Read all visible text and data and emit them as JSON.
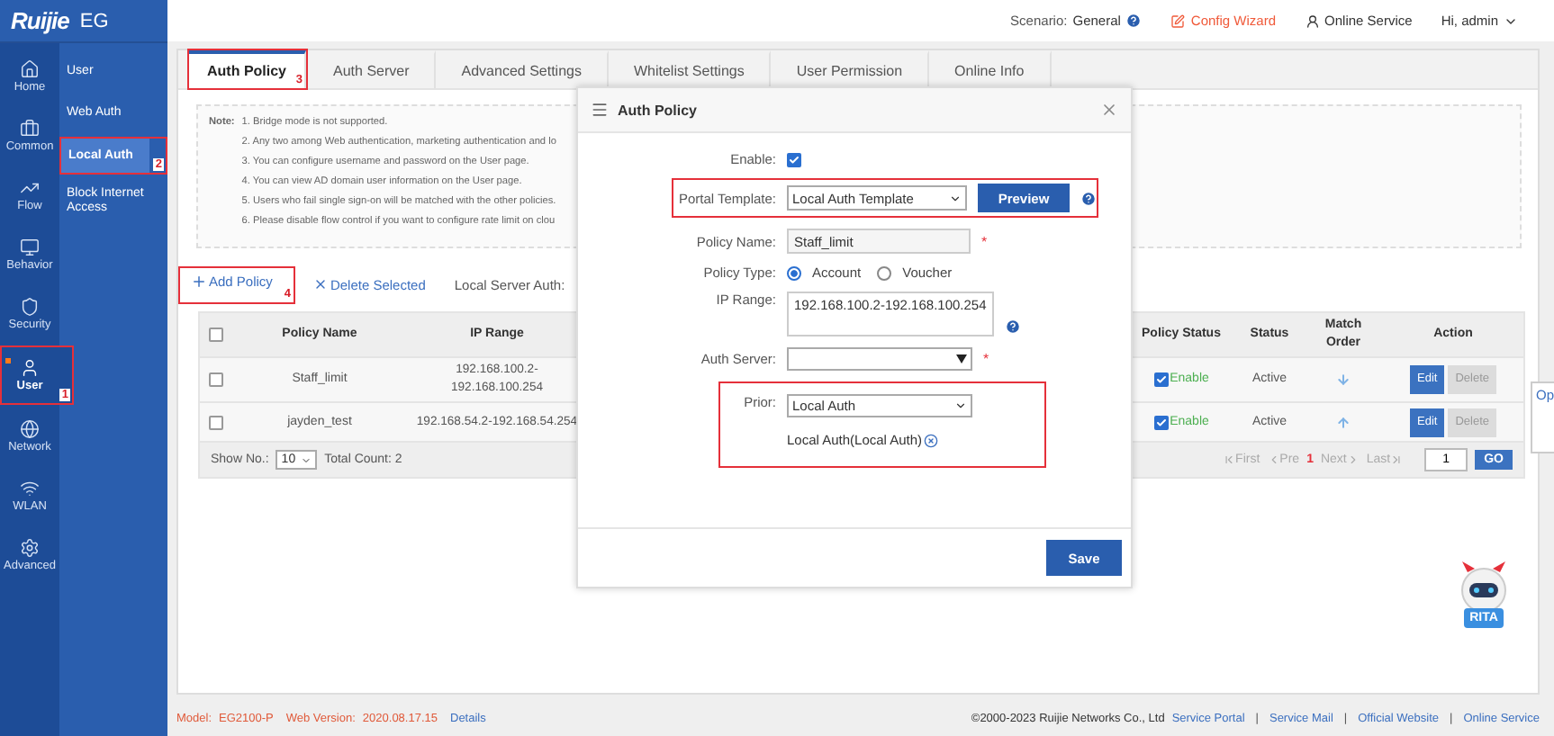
{
  "logo": {
    "brand": "Ruijie",
    "product": "EG"
  },
  "top_bar": {
    "scenario_label": "Scenario:",
    "scenario_value": "General",
    "config_wizard": "Config Wizard",
    "online_service": "Online Service",
    "user_menu": "Hi, admin"
  },
  "nav_rail": [
    {
      "label": "Home",
      "selected": false
    },
    {
      "label": "Common",
      "selected": false
    },
    {
      "label": "Flow",
      "selected": false
    },
    {
      "label": "Behavior",
      "selected": false
    },
    {
      "label": "Security",
      "selected": false
    },
    {
      "label": "User",
      "selected": true,
      "callout": "1"
    },
    {
      "label": "Network",
      "selected": false
    },
    {
      "label": "WLAN",
      "selected": false
    },
    {
      "label": "Advanced",
      "selected": false
    }
  ],
  "submenu": [
    {
      "label": "User",
      "selected": false
    },
    {
      "label": "Web Auth",
      "selected": false
    },
    {
      "label": "Local Auth",
      "selected": true,
      "callout": "2"
    },
    {
      "label": "Block Internet Access",
      "selected": false
    }
  ],
  "tabs": [
    {
      "label": "Auth Policy",
      "selected": true,
      "callout": "3"
    },
    {
      "label": "Auth Server",
      "selected": false
    },
    {
      "label": "Advanced Settings",
      "selected": false
    },
    {
      "label": "Whitelist Settings",
      "selected": false
    },
    {
      "label": "User Permission",
      "selected": false
    },
    {
      "label": "Online Info",
      "selected": false
    }
  ],
  "notes": {
    "label": "Note:",
    "lines": [
      "1. Bridge mode is not supported.",
      "2. Any two among Web authentication, marketing authentication and lo",
      "3. You can configure username and password on the User page.",
      "4. You can view AD domain user information on the User page.",
      "5. Users who fail single sign-on will be matched with the other policies.",
      "6. Please disable flow control if you want to configure rate limit on clou"
    ]
  },
  "toolbar": {
    "add": {
      "label": "Add Policy",
      "callout": "4"
    },
    "delete": "Delete Selected",
    "server_auth_label": "Local Server Auth:"
  },
  "table": {
    "columns": [
      "Policy Name",
      "IP Range",
      "Policy Status",
      "Status",
      "Match Order",
      "Action"
    ],
    "select_all_checked": false,
    "rows": [
      {
        "checked": false,
        "policy_name": "Staff_limit",
        "ip_range": "192.168.100.2-192.168.100.254",
        "enabled": true,
        "policy_status": "Enable",
        "status": "Active",
        "move_down": true,
        "actions": [
          "Edit",
          "Delete"
        ]
      },
      {
        "checked": false,
        "policy_name": "jayden_test",
        "ip_range": "192.168.54.2-192.168.54.254",
        "enabled": true,
        "policy_status": "Enable",
        "status": "Active",
        "move_down": false,
        "actions": [
          "Edit",
          "Delete"
        ]
      }
    ]
  },
  "pager": {
    "show_label": "Show No.:",
    "page_size": "10",
    "total": "Total Count: 2",
    "first": "First",
    "prev": "Pre",
    "current": "1",
    "next": "Next",
    "last": "Last",
    "page_input": "1",
    "go": "GO"
  },
  "dialog": {
    "title": "Auth Policy",
    "fields": [
      {
        "kind": "checkbox",
        "label": "Enable:",
        "checked": true,
        "highlighted": false
      },
      {
        "kind": "template",
        "label": "Portal Template:",
        "value": "Local Auth Template",
        "button": "Preview",
        "highlighted": true
      },
      {
        "kind": "text",
        "label": "Policy Name:",
        "value": "Staff_limit",
        "required_mark": "*",
        "highlighted": false
      },
      {
        "kind": "radio",
        "label": "Policy Type:",
        "options": [
          {
            "label": "Account",
            "selected": true
          },
          {
            "label": "Voucher",
            "selected": false
          }
        ],
        "highlighted": false
      },
      {
        "kind": "textarea",
        "label": "IP Range:",
        "value": "192.168.100.2-192.168.100.254",
        "highlighted": false
      },
      {
        "kind": "select",
        "label": "Auth Server:",
        "required_mark": "*",
        "highlighted": false
      },
      {
        "kind": "prior",
        "label": "Prior:",
        "value": "Local Auth",
        "chip": "Local Auth(Local Auth)",
        "highlighted": true
      }
    ],
    "save": "Save"
  },
  "mascot": {
    "label": "RITA"
  },
  "side_popup": {
    "label": "Op"
  },
  "footer": {
    "model_label": "Model:",
    "model": "EG2100-P",
    "version_label": "Web Version:",
    "version": "2020.08.17.15",
    "details": "Details",
    "copyright": "©2000-2023 Ruijie Networks Co., Ltd",
    "links": [
      {
        "label": "Service Portal"
      },
      {
        "separator": "|",
        "label": "Service Mail"
      },
      {
        "separator": "|",
        "label": "Official Website"
      },
      {
        "separator": "|",
        "label": "Online Service"
      }
    ]
  }
}
